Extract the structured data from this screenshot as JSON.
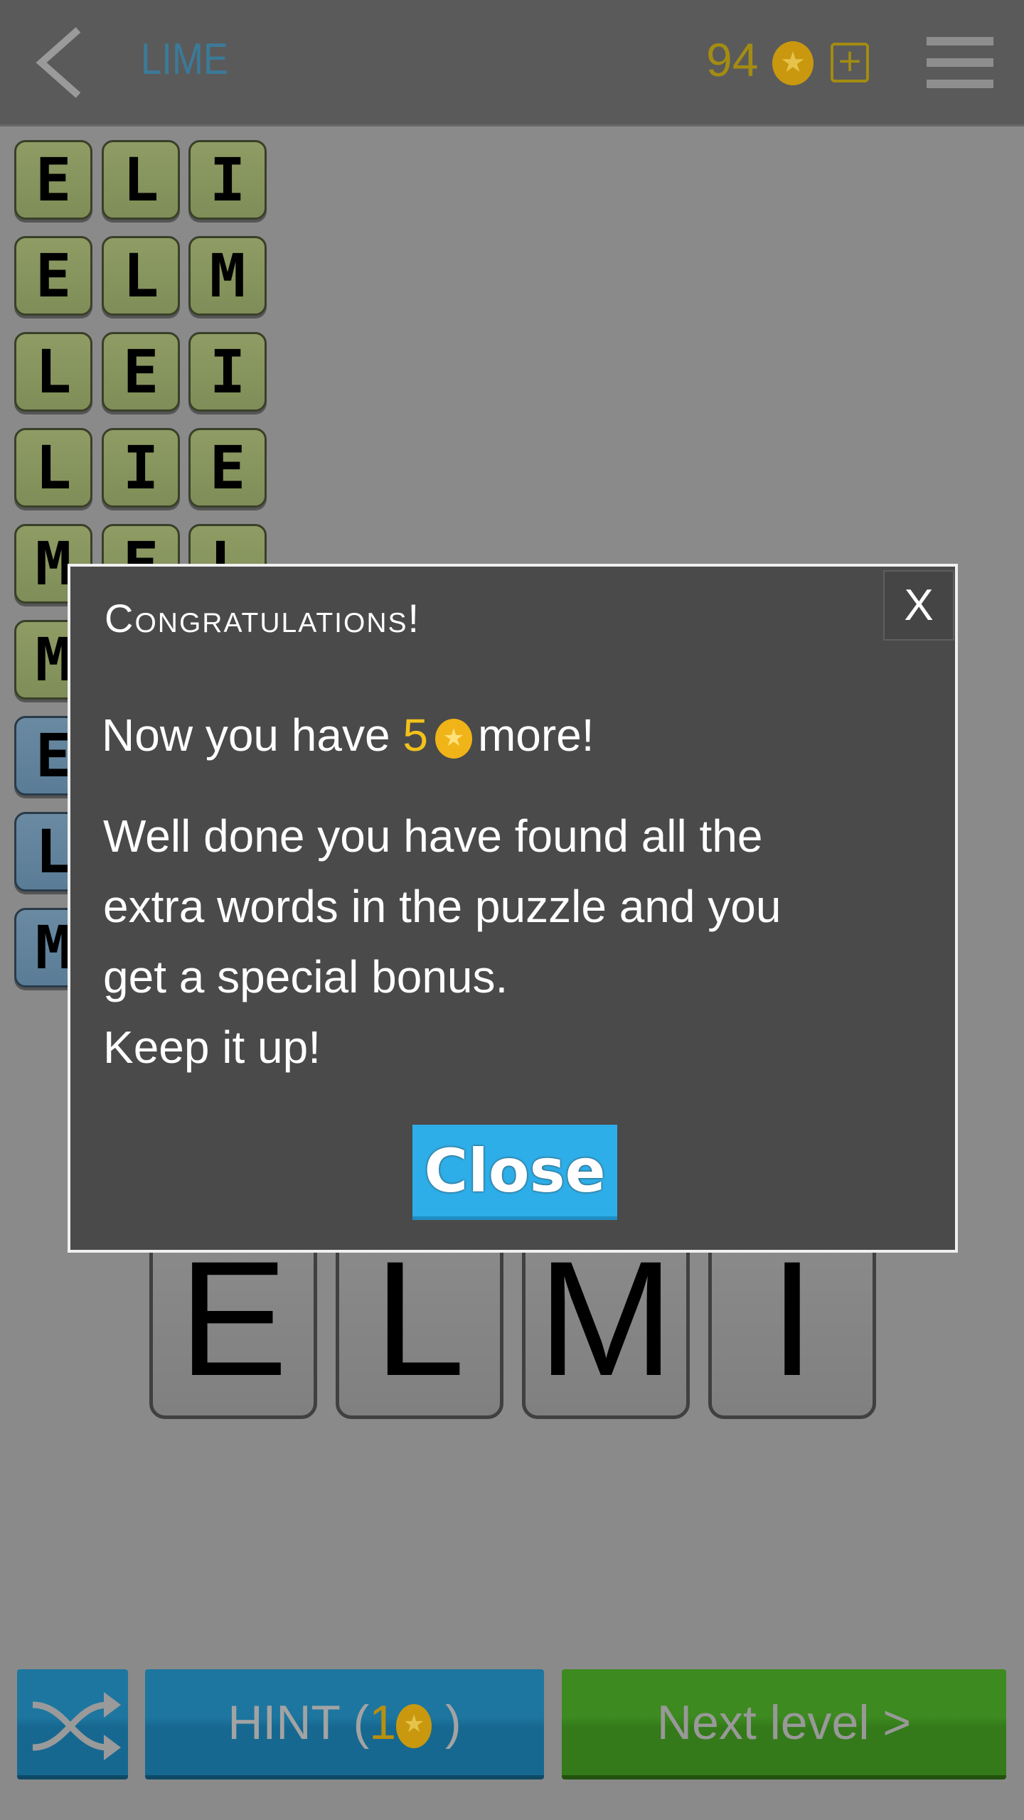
{
  "header": {
    "title": "LIME",
    "coins": "94",
    "coin_icon": "coin-star-icon",
    "plus_label": "+"
  },
  "found_words": [
    {
      "letters": [
        "E",
        "L",
        "I"
      ],
      "color": "green"
    },
    {
      "letters": [
        "E",
        "L",
        "M"
      ],
      "color": "green"
    },
    {
      "letters": [
        "L",
        "E",
        "I"
      ],
      "color": "green"
    },
    {
      "letters": [
        "L",
        "I",
        "E"
      ],
      "color": "green"
    },
    {
      "letters": [
        "M",
        "E",
        "L"
      ],
      "color": "green"
    },
    {
      "letters": [
        "M"
      ],
      "color": "green"
    },
    {
      "letters": [
        "E"
      ],
      "color": "blue"
    },
    {
      "letters": [
        "L"
      ],
      "color": "blue"
    },
    {
      "letters": [
        "M"
      ],
      "color": "blue"
    }
  ],
  "letter_tiles": [
    "E",
    "L",
    "M",
    "I"
  ],
  "dialog": {
    "title": "Congratulations!",
    "close_x": "X",
    "reward_prefix": "Now you have",
    "reward_amount": "5",
    "reward_suffix": "more!",
    "body_lines": [
      "Well done you have found all the",
      "extra words in the puzzle and you",
      "get a special bonus.",
      "Keep it up!"
    ],
    "close_button": "Close"
  },
  "bottom": {
    "hint_label": "HINT (",
    "hint_cost": "1",
    "hint_close": ")",
    "next_label": "Next level >"
  },
  "colors": {
    "hint_blue": "#1d76a0",
    "next_green": "#3d8a20",
    "close_blue": "#2eaee8",
    "coin_gold": "#f2c21b"
  }
}
